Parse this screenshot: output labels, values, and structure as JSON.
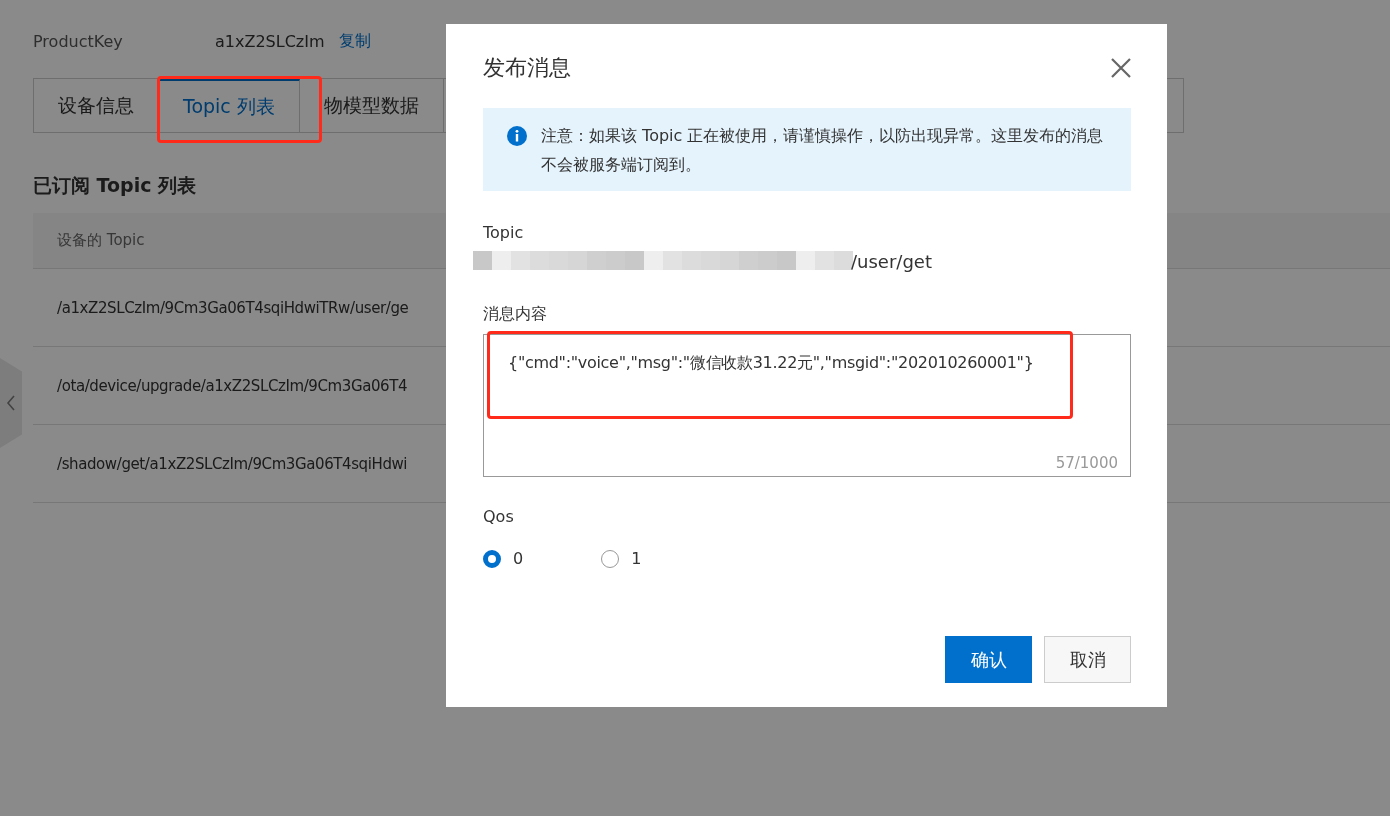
{
  "product_key": {
    "label": "ProductKey",
    "value": "a1xZ2SLCzIm",
    "action": "复制"
  },
  "tabs": [
    {
      "label": "设备信息",
      "selected": false
    },
    {
      "label": "Topic 列表",
      "selected": true
    },
    {
      "label": "物模型数据",
      "selected": false
    }
  ],
  "section_title": "已订阅 Topic 列表",
  "table": {
    "columns": [
      "设备的 Topic"
    ],
    "rows": [
      [
        "/a1xZ2SLCzIm/9Cm3Ga06T4sqiHdwiTRw/user/ge"
      ],
      [
        "/ota/device/upgrade/a1xZ2SLCzIm/9Cm3Ga06T4"
      ],
      [
        "/shadow/get/a1xZ2SLCzIm/9Cm3Ga06T4sqiHdwi"
      ]
    ]
  },
  "dialog": {
    "title": "发布消息",
    "notice": "注意：如果该 Topic 正在被使用，请谨慎操作，以防出现异常。这里发布的消息不会被服务端订阅到。",
    "topic": {
      "label": "Topic",
      "value": "/user/get"
    },
    "message": {
      "label": "消息内容",
      "value": "{\"cmd\":\"voice\",\"msg\":\"微信收款31.22元\",\"msgid\":\"202010260001\"}",
      "counter": "57/1000"
    },
    "qos": {
      "label": "Qos",
      "options": [
        {
          "label": "0",
          "selected": true
        },
        {
          "label": "1",
          "selected": false
        }
      ]
    },
    "buttons": [
      {
        "label": "确认",
        "kind": "primary"
      },
      {
        "label": "取消",
        "kind": "default"
      }
    ]
  }
}
